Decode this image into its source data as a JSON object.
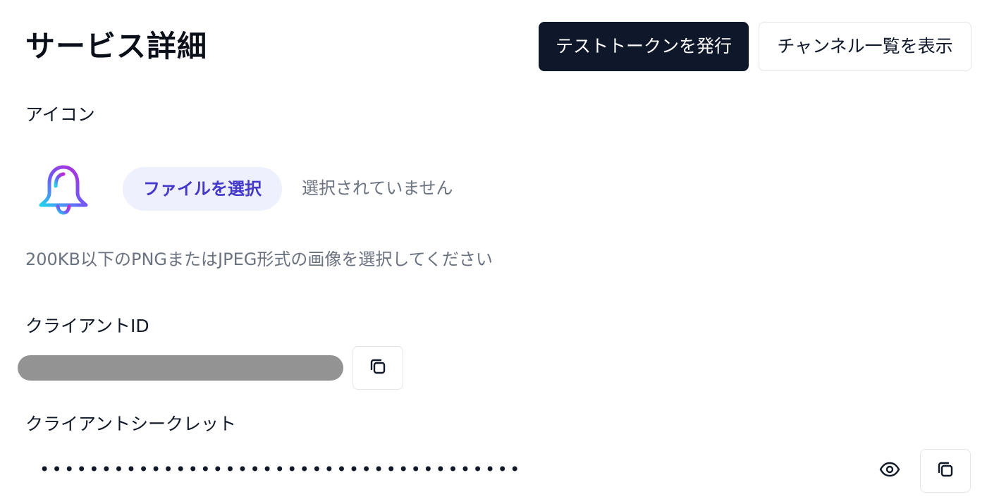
{
  "header": {
    "title": "サービス詳細",
    "primary_button_label": "テストトークンを発行",
    "secondary_button_label": "チャンネル一覧を表示"
  },
  "icon_section": {
    "label": "アイコン",
    "icon": "bell-icon",
    "file_button_label": "ファイルを選択",
    "file_status": "選択されていません",
    "hint": "200KB以下のPNGまたはJPEG形式の画像を選択してください"
  },
  "client_id": {
    "label": "クライアントID",
    "copy_icon": "copy-icon"
  },
  "client_secret": {
    "label": "クライアントシークレット",
    "masked_value": "•••••••••••••••••••••••••••••••••••••••",
    "reveal_icon": "eye-icon",
    "copy_icon": "copy-icon"
  },
  "colors": {
    "primary_button": "#0f172a",
    "file_button_bg": "#eef0fd",
    "file_button_text": "#4338ca",
    "muted_text": "#6b7280",
    "masked_bar": "#939393"
  }
}
